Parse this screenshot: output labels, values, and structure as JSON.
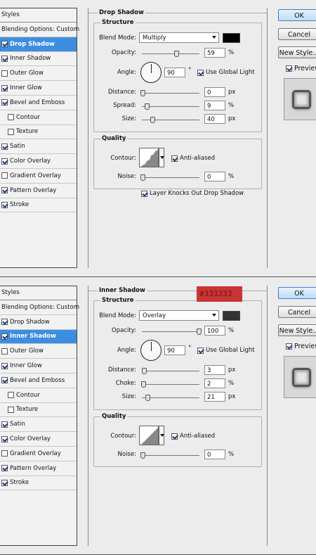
{
  "panels": [
    {
      "styles_header": "Styles",
      "blending_label": "Blending Options: Custom",
      "items": [
        {
          "label": "Drop Shadow",
          "checked": true,
          "selected": true,
          "sub": false
        },
        {
          "label": "Inner Shadow",
          "checked": true,
          "selected": false,
          "sub": false
        },
        {
          "label": "Outer Glow",
          "checked": false,
          "selected": false,
          "sub": false
        },
        {
          "label": "Inner Glow",
          "checked": true,
          "selected": false,
          "sub": false
        },
        {
          "label": "Bevel and Emboss",
          "checked": true,
          "selected": false,
          "sub": false
        },
        {
          "label": "Contour",
          "checked": false,
          "selected": false,
          "sub": true
        },
        {
          "label": "Texture",
          "checked": false,
          "selected": false,
          "sub": true
        },
        {
          "label": "Satin",
          "checked": true,
          "selected": false,
          "sub": false
        },
        {
          "label": "Color Overlay",
          "checked": true,
          "selected": false,
          "sub": false
        },
        {
          "label": "Gradient Overlay",
          "checked": false,
          "selected": false,
          "sub": false
        },
        {
          "label": "Pattern Overlay",
          "checked": true,
          "selected": false,
          "sub": false
        },
        {
          "label": "Stroke",
          "checked": true,
          "selected": false,
          "sub": false
        }
      ],
      "section_title": "Drop Shadow",
      "structure_title": "Structure",
      "blend_mode_label": "Blend Mode:",
      "blend_mode": "Multiply",
      "swatch_color": "#000000",
      "opacity_label": "Opacity:",
      "opacity": "59",
      "opacity_unit": "%",
      "angle_label": "Angle:",
      "angle": "90",
      "angle_unit": "°",
      "global_light_label": "Use Global Light",
      "global_light": true,
      "param2_label": "Distance:",
      "param2": "0",
      "param2_unit": "px",
      "param3_label": "Spread:",
      "param3": "9",
      "param3_unit": "%",
      "size_label": "Size:",
      "size": "40",
      "size_unit": "px",
      "quality_title": "Quality",
      "contour_label": "Contour:",
      "antialiased_label": "Anti-aliased",
      "antialiased": true,
      "noise_label": "Noise:",
      "noise": "0",
      "noise_unit": "%",
      "knockout_label": "Layer Knocks Out Drop Shadow",
      "knockout": true,
      "levels": {
        "opacity": 0.59,
        "distance": 0.0,
        "param3": 0.09,
        "size": 0.16,
        "noise": 0.0
      }
    },
    {
      "styles_header": "Styles",
      "blending_label": "Blending Options: Custom",
      "items": [
        {
          "label": "Drop Shadow",
          "checked": true,
          "selected": false,
          "sub": false
        },
        {
          "label": "Inner Shadow",
          "checked": true,
          "selected": true,
          "sub": false
        },
        {
          "label": "Outer Glow",
          "checked": false,
          "selected": false,
          "sub": false
        },
        {
          "label": "Inner Glow",
          "checked": true,
          "selected": false,
          "sub": false
        },
        {
          "label": "Bevel and Emboss",
          "checked": true,
          "selected": false,
          "sub": false
        },
        {
          "label": "Contour",
          "checked": false,
          "selected": false,
          "sub": true
        },
        {
          "label": "Texture",
          "checked": false,
          "selected": false,
          "sub": true
        },
        {
          "label": "Satin",
          "checked": true,
          "selected": false,
          "sub": false
        },
        {
          "label": "Color Overlay",
          "checked": true,
          "selected": false,
          "sub": false
        },
        {
          "label": "Gradient Overlay",
          "checked": false,
          "selected": false,
          "sub": false
        },
        {
          "label": "Pattern Overlay",
          "checked": true,
          "selected": false,
          "sub": false
        },
        {
          "label": "Stroke",
          "checked": true,
          "selected": false,
          "sub": false
        }
      ],
      "section_title": "Inner Shadow",
      "structure_title": "Structure",
      "blend_mode_label": "Blend Mode:",
      "blend_mode": "Overlay",
      "swatch_color": "#333333",
      "hex_note": "#333333",
      "opacity_label": "Opacity:",
      "opacity": "100",
      "opacity_unit": "%",
      "angle_label": "Angle:",
      "angle": "90",
      "angle_unit": "°",
      "global_light_label": "Use Global Light",
      "global_light": true,
      "param2_label": "Distance:",
      "param2": "3",
      "param2_unit": "px",
      "param3_label": "Choke:",
      "param3": "2",
      "param3_unit": "%",
      "size_label": "Size:",
      "size": "21",
      "size_unit": "px",
      "quality_title": "Quality",
      "contour_label": "Contour:",
      "antialiased_label": "Anti-aliased",
      "antialiased": true,
      "noise_label": "Noise:",
      "noise": "0",
      "noise_unit": "%",
      "levels": {
        "opacity": 1.0,
        "distance": 0.03,
        "param3": 0.02,
        "size": 0.08,
        "noise": 0.0
      }
    }
  ],
  "buttons": {
    "ok": "OK",
    "cancel": "Cancel",
    "new_style": "New Style...",
    "preview": "Preview",
    "preview_checked": true
  }
}
